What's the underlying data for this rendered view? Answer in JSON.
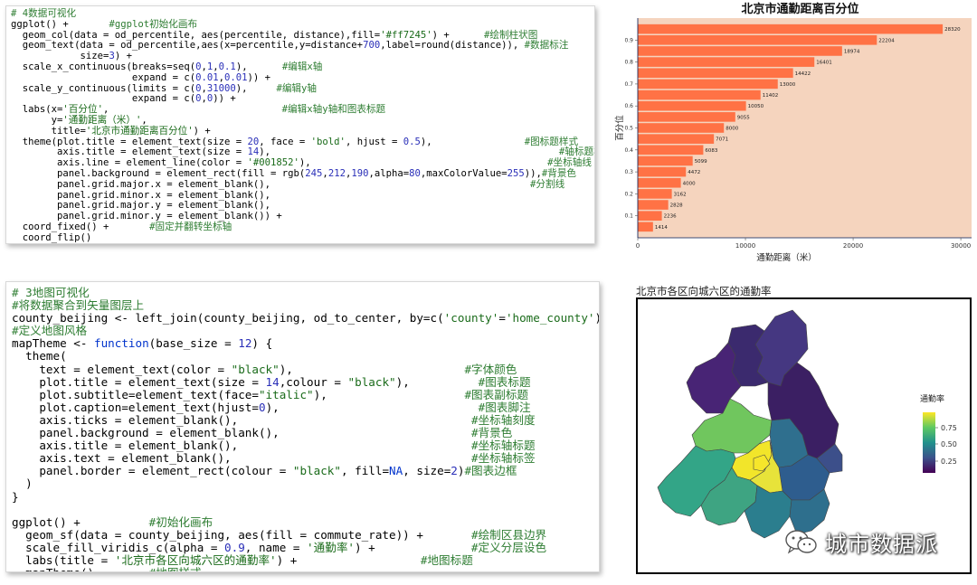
{
  "code_top": [
    [
      [
        "c",
        "# 4数据可视化"
      ]
    ],
    [
      [
        "t",
        "ggplot() +       "
      ],
      [
        "c",
        "#ggplot初始化画布"
      ]
    ],
    [
      [
        "t",
        "  geom_col(data = od_percentile, aes(percentile, distance),fill="
      ],
      [
        "s",
        "'#ff7245'"
      ],
      [
        "t",
        ") +      "
      ],
      [
        "c",
        "#绘制柱状图"
      ]
    ],
    [
      [
        "t",
        "  geom_text(data = od_percentile,aes(x=percentile,y=distance+"
      ],
      [
        "n",
        "700"
      ],
      [
        "t",
        ",label=round(distance)), "
      ],
      [
        "c",
        "#数据标注"
      ]
    ],
    [
      [
        "t",
        "            size="
      ],
      [
        "n",
        "3"
      ],
      [
        "t",
        ") +"
      ]
    ],
    [
      [
        "t",
        "  scale_x_continuous(breaks=seq("
      ],
      [
        "n",
        "0"
      ],
      [
        "t",
        ","
      ],
      [
        "n",
        "1"
      ],
      [
        "t",
        ","
      ],
      [
        "n",
        "0.1"
      ],
      [
        "t",
        "),      "
      ],
      [
        "c",
        "#编辑x轴"
      ]
    ],
    [
      [
        "t",
        "                     expand = c("
      ],
      [
        "n",
        "0.01"
      ],
      [
        "t",
        ","
      ],
      [
        "n",
        "0.01"
      ],
      [
        "t",
        ")) +"
      ]
    ],
    [
      [
        "t",
        "  scale_y_continuous(limits = c("
      ],
      [
        "n",
        "0"
      ],
      [
        "t",
        ","
      ],
      [
        "n",
        "31000"
      ],
      [
        "t",
        "),     "
      ],
      [
        "c",
        "#编辑y轴"
      ]
    ],
    [
      [
        "t",
        "                     expand = c("
      ],
      [
        "n",
        "0"
      ],
      [
        "t",
        ","
      ],
      [
        "n",
        "0"
      ],
      [
        "t",
        ")) +"
      ]
    ],
    [
      [
        "t",
        "  labs(x="
      ],
      [
        "s",
        "'百分位'"
      ],
      [
        "t",
        ",                              "
      ],
      [
        "c",
        "#编辑x轴y轴和图表标题"
      ]
    ],
    [
      [
        "t",
        "       y="
      ],
      [
        "s",
        "'通勤距离（米）'"
      ],
      [
        "t",
        ","
      ]
    ],
    [
      [
        "t",
        "       title="
      ],
      [
        "s",
        "'北京市通勤距离百分位'"
      ],
      [
        "t",
        ") +"
      ]
    ],
    [
      [
        "t",
        "  theme(plot.title = element_text(size = "
      ],
      [
        "n",
        "20"
      ],
      [
        "t",
        ", face = "
      ],
      [
        "s",
        "'bold'"
      ],
      [
        "t",
        ", hjust = "
      ],
      [
        "n",
        "0.5"
      ],
      [
        "t",
        "),                "
      ],
      [
        "c",
        "#图标题样式"
      ]
    ],
    [
      [
        "t",
        "        axis.title = element_text(size = "
      ],
      [
        "n",
        "14"
      ],
      [
        "t",
        "),                                                  "
      ],
      [
        "c",
        "#轴标题样式"
      ]
    ],
    [
      [
        "t",
        "        axis.line = element_line(color = "
      ],
      [
        "s",
        "'#001852'"
      ],
      [
        "t",
        "),                                         "
      ],
      [
        "c",
        "#坐标轴线"
      ]
    ],
    [
      [
        "t",
        "        panel.background = element_rect(fill = rgb("
      ],
      [
        "n",
        "245"
      ],
      [
        "t",
        ","
      ],
      [
        "n",
        "212"
      ],
      [
        "t",
        ","
      ],
      [
        "n",
        "190"
      ],
      [
        "t",
        ",alpha="
      ],
      [
        "n",
        "80"
      ],
      [
        "t",
        ",maxColorValue="
      ],
      [
        "n",
        "255"
      ],
      [
        "t",
        ")),"
      ],
      [
        "c",
        "#背景色"
      ]
    ],
    [
      [
        "t",
        "        panel.grid.major.x = element_blank(),                                             "
      ],
      [
        "c",
        "#分割线"
      ]
    ],
    [
      [
        "t",
        "        panel.grid.minor.x = element_blank(),"
      ]
    ],
    [
      [
        "t",
        "        panel.grid.major.y = element_blank(),"
      ]
    ],
    [
      [
        "t",
        "        panel.grid.minor.y = element_blank()) +"
      ]
    ],
    [
      [
        "t",
        "  coord_fixed() +       "
      ],
      [
        "c",
        "#固定并翻转坐标轴"
      ]
    ],
    [
      [
        "t",
        "  coord_flip()"
      ]
    ]
  ],
  "code_bottom": [
    [
      [
        "c",
        "# 3地图可视化"
      ]
    ],
    [
      [
        "c",
        "#将数据聚合到矢量图层上"
      ]
    ],
    [
      [
        "t",
        "county_beijing <- left_join(county_beijing, od_to_center, by=c("
      ],
      [
        "s",
        "'county'"
      ],
      [
        "t",
        "="
      ],
      [
        "s",
        "'home_county'"
      ],
      [
        "t",
        "))"
      ]
    ],
    [
      [
        "c",
        "#定义地图风格"
      ]
    ],
    [
      [
        "t",
        "mapTheme <- "
      ],
      [
        "k",
        "function"
      ],
      [
        "t",
        "(base_size = "
      ],
      [
        "n",
        "12"
      ],
      [
        "t",
        ") {"
      ]
    ],
    [
      [
        "t",
        "  theme("
      ]
    ],
    [
      [
        "t",
        "    text = element_text(color = "
      ],
      [
        "s",
        "\"black\""
      ],
      [
        "t",
        "),                         "
      ],
      [
        "c",
        "#字体颜色"
      ]
    ],
    [
      [
        "t",
        "    plot.title = element_text(size = "
      ],
      [
        "n",
        "14"
      ],
      [
        "t",
        ",colour = "
      ],
      [
        "s",
        "\"black\""
      ],
      [
        "t",
        "),          "
      ],
      [
        "c",
        "#图表标题"
      ]
    ],
    [
      [
        "t",
        "    plot.subtitle=element_text(face="
      ],
      [
        "s",
        "\"italic\""
      ],
      [
        "t",
        "),                    "
      ],
      [
        "c",
        "#图表副标题"
      ]
    ],
    [
      [
        "t",
        "    plot.caption=element_text(hjust="
      ],
      [
        "n",
        "0"
      ],
      [
        "t",
        "),                             "
      ],
      [
        "c",
        "#图表脚注"
      ]
    ],
    [
      [
        "t",
        "    axis.ticks = element_blank(),                                  "
      ],
      [
        "c",
        "#坐标轴刻度"
      ]
    ],
    [
      [
        "t",
        "    panel.background = element_blank(),                            "
      ],
      [
        "c",
        "#背景色"
      ]
    ],
    [
      [
        "t",
        "    axis.title = element_blank(),                                  "
      ],
      [
        "c",
        "#坐标轴标题"
      ]
    ],
    [
      [
        "t",
        "    axis.text = element_blank(),                                   "
      ],
      [
        "c",
        "#坐标轴标签"
      ]
    ],
    [
      [
        "t",
        "    panel.border = element_rect(colour = "
      ],
      [
        "s",
        "\"black\""
      ],
      [
        "t",
        ", fill="
      ],
      [
        "k",
        "NA"
      ],
      [
        "t",
        ", size="
      ],
      [
        "n",
        "2"
      ],
      [
        "t",
        ")"
      ],
      [
        "c",
        "#图表边框"
      ]
    ],
    [
      [
        "t",
        "  )"
      ]
    ],
    [
      [
        "t",
        "}"
      ]
    ],
    [
      [
        "t",
        ""
      ]
    ],
    [
      [
        "t",
        "ggplot() +          "
      ],
      [
        "c",
        "#初始化画布"
      ]
    ],
    [
      [
        "t",
        "  geom_sf(data = county_beijing, aes(fill = commute_rate)) +       "
      ],
      [
        "c",
        "#绘制区县边界"
      ]
    ],
    [
      [
        "t",
        "  scale_fill_viridis_c(alpha = "
      ],
      [
        "n",
        "0.9"
      ],
      [
        "t",
        ", name = "
      ],
      [
        "s",
        "'通勤率'"
      ],
      [
        "t",
        ") +              "
      ],
      [
        "c",
        "#定义分层设色"
      ]
    ],
    [
      [
        "t",
        "  labs(title = "
      ],
      [
        "s",
        "'北京市各区向城六区的通勤率'"
      ],
      [
        "t",
        ") +                  "
      ],
      [
        "c",
        "#地图标题"
      ]
    ],
    [
      [
        "t",
        "  mapTheme()        "
      ],
      [
        "c",
        "#地图样式"
      ]
    ]
  ],
  "chart_data": [
    {
      "type": "bar",
      "orientation": "horizontal",
      "title": "北京市通勤距离百分位",
      "xlabel": "通勤距离（米）",
      "ylabel": "百分位",
      "y": [
        0.05,
        0.1,
        0.15,
        0.2,
        0.25,
        0.3,
        0.35,
        0.4,
        0.45,
        0.5,
        0.55,
        0.6,
        0.65,
        0.7,
        0.75,
        0.8,
        0.85,
        0.9,
        0.95
      ],
      "values": [
        1414,
        2236,
        2828,
        3162,
        4000,
        4472,
        5099,
        6083,
        7071,
        8000,
        9055,
        10050,
        11402,
        13000,
        14422,
        16401,
        18974,
        22204,
        28320
      ],
      "labels": [
        "1414",
        "2236",
        "2828",
        "3162",
        "4000",
        "4472",
        "5099",
        "6083",
        "7071",
        "8000",
        "9055",
        "10050",
        "11402",
        "13000",
        "14422",
        "16401",
        "18974",
        "22204",
        "28320"
      ],
      "xticks": [
        0,
        10000,
        20000,
        30000
      ],
      "xtick_labels": [
        "0",
        "10000",
        "20000",
        "30000"
      ],
      "yticks": [
        0.1,
        0.2,
        0.3,
        0.4,
        0.5,
        0.6,
        0.7,
        0.8,
        0.9
      ],
      "ytick_labels": [
        "0.1",
        "0.2",
        "0.3",
        "0.4",
        "0.5",
        "0.6",
        "0.7",
        "0.8",
        "0.9"
      ],
      "xlim": [
        0,
        31000
      ],
      "bar_color": "#ff7245",
      "panel_background": "#f5d4be",
      "grid": false
    },
    {
      "type": "choropleth",
      "title": "北京市各区向城六区的通勤率",
      "legend_title": "通勤率",
      "legend_ticks": [
        0.75,
        0.5,
        0.25
      ],
      "legend_tick_labels": [
        "0.75",
        "0.50",
        "0.25"
      ],
      "color_scale": "viridis",
      "legend_position": "right"
    }
  ],
  "watermark": {
    "text": "城市数据派",
    "icon": "wechat-icon"
  }
}
